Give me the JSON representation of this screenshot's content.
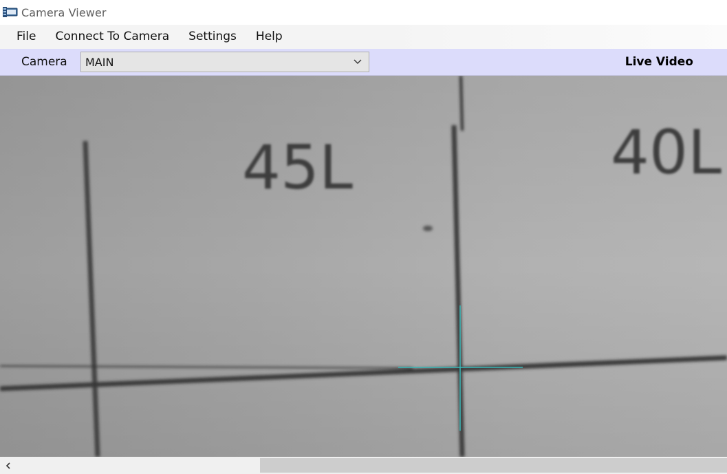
{
  "window": {
    "title": "Camera Viewer",
    "icon": "camera-app-icon"
  },
  "menu": {
    "items": [
      "File",
      "Connect To Camera",
      "Settings",
      "Help"
    ]
  },
  "toolbar": {
    "camera_label": "Camera",
    "camera_selected": "MAIN",
    "mode_label": "Live Video",
    "background_color": "#dcdcfb"
  },
  "video": {
    "marks": [
      "45L",
      "40L"
    ],
    "crosshair_color": "#39b8b8"
  },
  "scrollbar": {
    "left_arrow": "chevron-left-icon"
  }
}
